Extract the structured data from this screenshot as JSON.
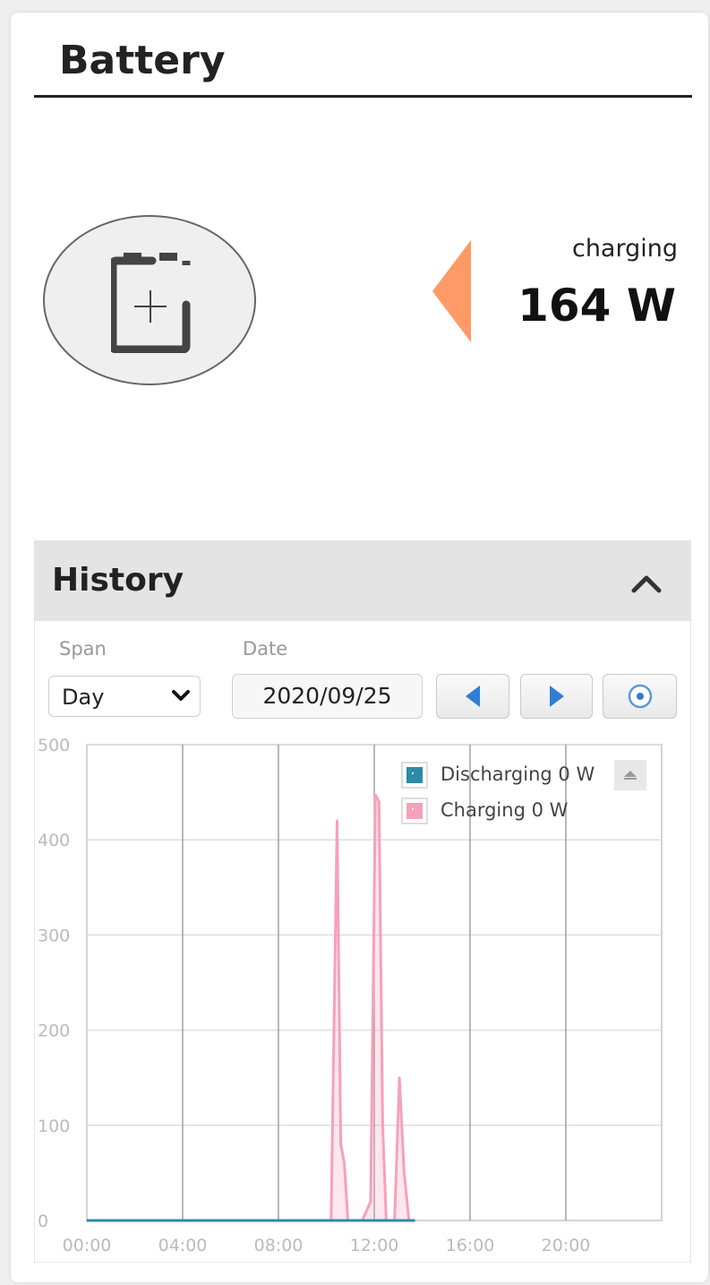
{
  "panel": {
    "title": "Battery"
  },
  "battery": {
    "icon": "battery-charging-icon",
    "state_label": "charging",
    "power_value": "164 W",
    "flow_arrow_color": "#fe9a66"
  },
  "history": {
    "title": "History",
    "collapse_icon": "chevron-up-icon",
    "span": {
      "label": "Span",
      "value": "Day"
    },
    "date": {
      "label": "Date",
      "value": "2020/09/25"
    },
    "buttons": {
      "prev_icon": "triangle-left-icon",
      "next_icon": "triangle-right-icon",
      "today_icon": "record-icon"
    }
  },
  "chart_data": {
    "type": "area",
    "ylim": [
      0,
      500
    ],
    "yticks": [
      "0",
      "100",
      "200",
      "300",
      "400",
      "500"
    ],
    "xlim": [
      0,
      24
    ],
    "xticks": [
      "00:00",
      "04:00",
      "08:00",
      "12:00",
      "16:00",
      "20:00"
    ],
    "grid": true,
    "legend_position": "top-right",
    "series": [
      {
        "name": "Discharging 0 W",
        "color": "#2d8aa8",
        "points": [
          [
            0,
            0
          ],
          [
            4.5,
            0
          ],
          [
            9.7,
            0
          ],
          [
            13.7,
            0
          ]
        ]
      },
      {
        "name": "Charging 0 W",
        "color": "#f7a1b8",
        "points": [
          [
            0,
            0
          ],
          [
            4.5,
            0
          ],
          [
            9.7,
            0
          ],
          [
            10.2,
            0
          ],
          [
            10.45,
            420
          ],
          [
            10.6,
            80
          ],
          [
            10.75,
            60
          ],
          [
            10.9,
            0
          ],
          [
            11.5,
            0
          ],
          [
            11.85,
            20
          ],
          [
            12.05,
            447
          ],
          [
            12.2,
            440
          ],
          [
            12.35,
            100
          ],
          [
            12.5,
            0
          ],
          [
            12.85,
            0
          ],
          [
            13.05,
            150
          ],
          [
            13.25,
            50
          ],
          [
            13.45,
            0
          ],
          [
            13.7,
            0
          ]
        ]
      }
    ]
  }
}
